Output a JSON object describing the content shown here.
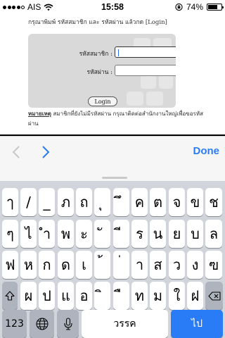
{
  "status_bar": {
    "carrier": "AIS",
    "time": "15:58",
    "battery_percent": "74%",
    "battery_level": 0.74,
    "icons": [
      "signal-dots-icon",
      "wifi-icon",
      "rotation-lock-icon",
      "battery-icon"
    ]
  },
  "page": {
    "instruction": "กรุณาพิมพ์ รหัสสมาชิก และ รหัสผ่าน แล้วกด [Login]",
    "member_label": "รหัสสมาชิก :",
    "member_value": "",
    "password_label": "รหัสผ่าน :",
    "password_value": "",
    "login_button": "Login",
    "note_title": "หมายเหตุ",
    "note_text": " สมาชิกที่ยังไม่มีรหัสผ่าน กรุณาติดต่อสำนักงานใหญ่เพื่อขอรหัสผ่าน"
  },
  "accessory": {
    "done_label": "Done",
    "icons": [
      "chevron-left-icon",
      "chevron-right-icon"
    ]
  },
  "keyboard": {
    "row1": [
      "ๅ",
      "/",
      "_",
      "ภ",
      "ถ",
      "ุ",
      "ึ",
      "ค",
      "ต",
      "จ",
      "ข",
      "ช"
    ],
    "row2": [
      "ๆ",
      "ไ",
      "ำ",
      "พ",
      "ะ",
      "ั",
      "ี",
      "ร",
      "น",
      "ย",
      "บ",
      "ล"
    ],
    "row3": [
      "ฟ",
      "ห",
      "ก",
      "ด",
      "เ",
      "้",
      "่",
      "า",
      "ส",
      "ว",
      "ง",
      "ฃ"
    ],
    "row4": [
      "ผ",
      "ป",
      "แ",
      "อ",
      "ิ",
      "ื",
      "ท",
      "ม",
      "ใ",
      "ฝ"
    ],
    "numbers_key": "123",
    "space_label": "วรรค",
    "return_label": "ไป",
    "accent_color": "#2a7cf6"
  }
}
